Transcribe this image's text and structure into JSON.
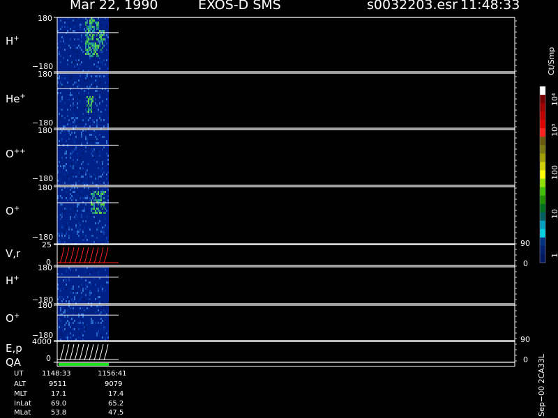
{
  "header": {
    "date": "Mar 22, 1990",
    "mission": "EXOS-D SMS",
    "file": "s0032203.esr",
    "time": "11:48:33"
  },
  "panels": [
    {
      "id": "h-plus-1",
      "label": "H",
      "sup": "+",
      "top_tick": "180",
      "bottom_tick": "−180"
    },
    {
      "id": "he-plus",
      "label": "He",
      "sup": "+",
      "top_tick": "180",
      "bottom_tick": "−180"
    },
    {
      "id": "o-plus-plus",
      "label": "O",
      "sup": "++",
      "top_tick": "180",
      "bottom_tick": "−180"
    },
    {
      "id": "o-plus-1",
      "label": "O",
      "sup": "+",
      "top_tick": "180",
      "bottom_tick": "−180"
    },
    {
      "id": "v-r",
      "label": "V,r",
      "sup": "",
      "top_tick": "25",
      "bottom_tick": "0",
      "right_top": "90",
      "right_bottom": "0"
    },
    {
      "id": "h-plus-2",
      "label": "H",
      "sup": "+",
      "top_tick": "180",
      "bottom_tick": "−180"
    },
    {
      "id": "o-plus-2",
      "label": "O",
      "sup": "+",
      "top_tick": "180",
      "bottom_tick": "−180"
    },
    {
      "id": "e-p",
      "label": "E,p",
      "sup": "",
      "top_tick": "4000",
      "bottom_tick": "0",
      "right_top": "90",
      "right_bottom": "0"
    }
  ],
  "qa_label": "QA",
  "colorbar": {
    "unit": "Ct/Smp",
    "ticks": [
      "10⁴",
      "10³",
      "100",
      "10",
      "1"
    ],
    "colors": [
      "#ffffff",
      "#7a0000",
      "#a00000",
      "#c00000",
      "#e00000",
      "#ff2020",
      "#6a5a10",
      "#7a7a10",
      "#a0a000",
      "#d0d000",
      "#ffff00",
      "#90e000",
      "#40c000",
      "#209000",
      "#007020",
      "#006060",
      "#00a0c0",
      "#00d0e0",
      "#003080",
      "#002070",
      "#001860"
    ]
  },
  "info": {
    "rows": [
      {
        "label": "UT",
        "start": "1148:33",
        "end": "1156:41"
      },
      {
        "label": "ALT",
        "start": "9511",
        "end": "9079"
      },
      {
        "label": "MLT",
        "start": "17.1",
        "end": "17.4"
      },
      {
        "label": "InLat",
        "start": "69.0",
        "end": "65.2"
      },
      {
        "label": "MLat",
        "start": "53.8",
        "end": "47.5"
      }
    ]
  },
  "side_code": "Sep−00 2CA33L",
  "chart_data": {
    "type": "heatmap",
    "title": "Mar 22, 1990   EXOS-D SMS",
    "series": [
      {
        "name": "H+",
        "yrange": [
          -180,
          180
        ]
      },
      {
        "name": "He+",
        "yrange": [
          -180,
          180
        ]
      },
      {
        "name": "O++",
        "yrange": [
          -180,
          180
        ]
      },
      {
        "name": "O+",
        "yrange": [
          -180,
          180
        ]
      },
      {
        "name": "V,r",
        "yrange": [
          0,
          25
        ],
        "right_range": [
          0,
          90
        ]
      },
      {
        "name": "H+",
        "yrange": [
          -180,
          180
        ]
      },
      {
        "name": "O+",
        "yrange": [
          -180,
          180
        ]
      },
      {
        "name": "E,p",
        "yrange": [
          0,
          4000
        ],
        "right_range": [
          0,
          90
        ]
      }
    ],
    "colorscale": {
      "unit": "Ct/Smp",
      "range": [
        1,
        10000
      ],
      "scale": "log"
    },
    "time_range": [
      "1148:33",
      "1156:41"
    ]
  }
}
